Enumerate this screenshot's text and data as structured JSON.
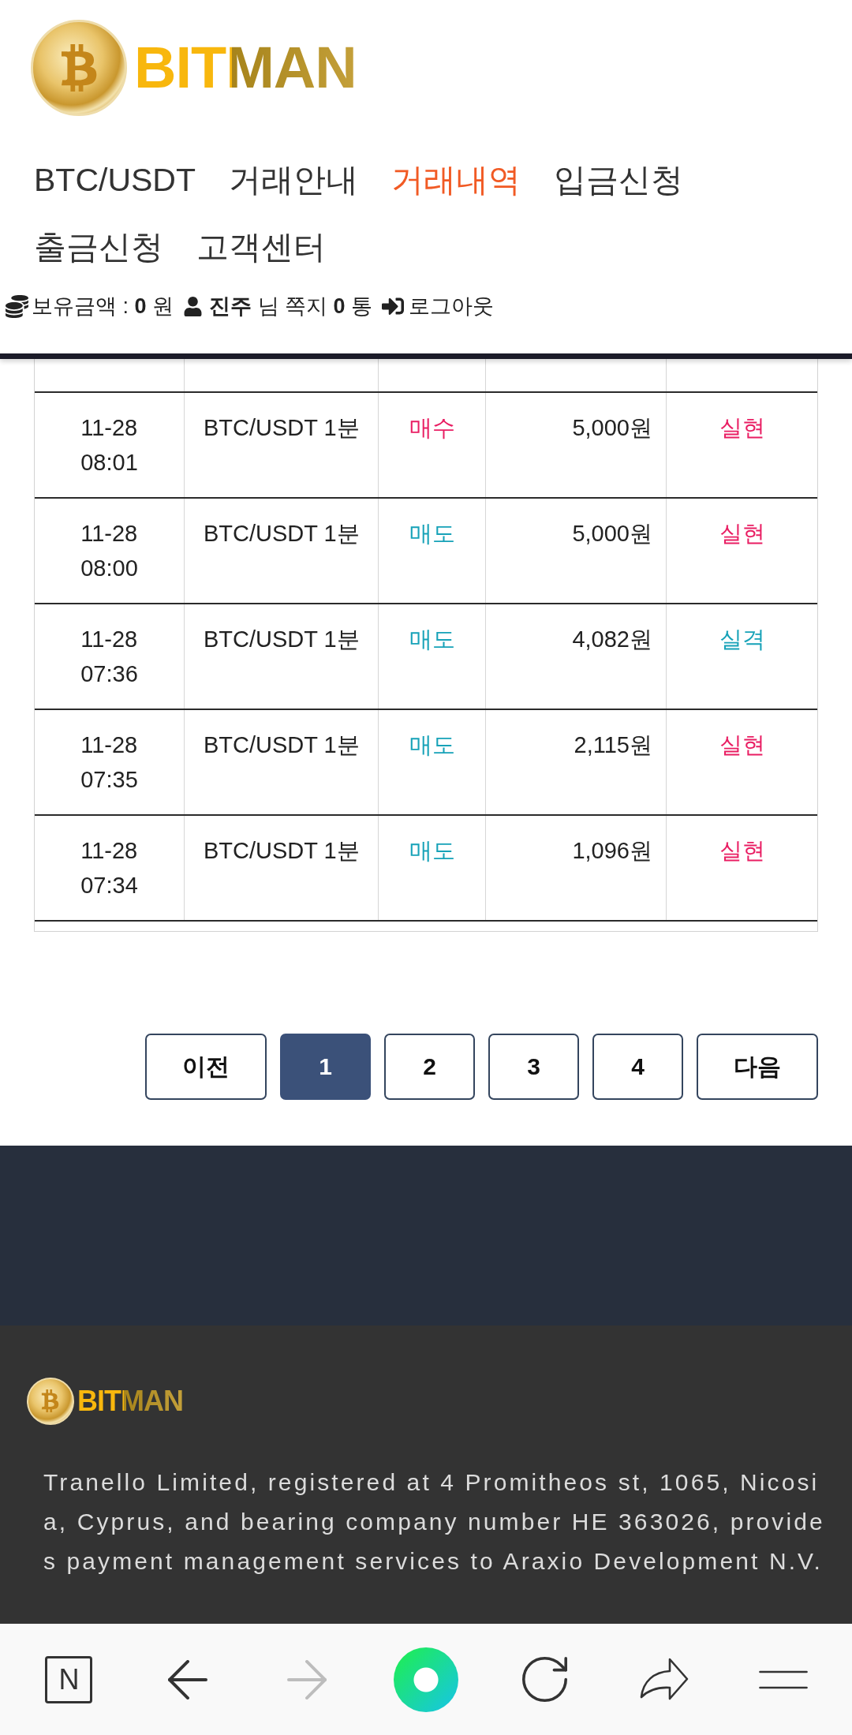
{
  "header": {
    "logo": "BITMAN"
  },
  "nav": [
    {
      "label": "BTC/USDT",
      "selected": false
    },
    {
      "label": "거래안내",
      "selected": false
    },
    {
      "label": "거래내역",
      "selected": true
    },
    {
      "label": "입금신청",
      "selected": false
    },
    {
      "label": "출금신청",
      "selected": false
    },
    {
      "label": "고객센터",
      "selected": false
    }
  ],
  "user_bar": {
    "balance": "보유금액 : **0** 원",
    "greeting": "**진주** 님 쪽지 **0** 통",
    "logout": "로그아웃"
  },
  "table": {
    "rows": [
      {
        "datetime": "11-28\n08:01",
        "market": "BTC/USDT 1분",
        "side": {
          "text": "매수",
          "color": "#e91e63"
        },
        "amount": "5,000원",
        "result": {
          "text": "실현",
          "color": "#e91e63"
        }
      },
      {
        "datetime": "11-28\n08:00",
        "market": "BTC/USDT 1분",
        "side": {
          "text": "매도",
          "color": "#17a2b8"
        },
        "amount": "5,000원",
        "result": {
          "text": "실현",
          "color": "#e91e63"
        }
      },
      {
        "datetime": "11-28\n07:36",
        "market": "BTC/USDT 1분",
        "side": {
          "text": "매도",
          "color": "#17a2b8"
        },
        "amount": "4,082원",
        "result": {
          "text": "실격",
          "color": "#17a2b8"
        }
      },
      {
        "datetime": "11-28\n07:35",
        "market": "BTC/USDT 1분",
        "side": {
          "text": "매도",
          "color": "#17a2b8"
        },
        "amount": "2,115원",
        "result": {
          "text": "실현",
          "color": "#e91e63"
        }
      },
      {
        "datetime": "11-28\n07:34",
        "market": "BTC/USDT 1분",
        "side": {
          "text": "매도",
          "color": "#17a2b8"
        },
        "amount": "1,096원",
        "result": {
          "text": "실현",
          "color": "#e91e63"
        }
      }
    ]
  },
  "pagination": [
    {
      "kind": "prev",
      "label": "이전",
      "selected": false
    },
    {
      "kind": "page",
      "label": "1",
      "selected": true
    },
    {
      "kind": "page",
      "label": "2",
      "selected": false
    },
    {
      "kind": "page",
      "label": "3",
      "selected": false
    },
    {
      "kind": "page",
      "label": "4",
      "selected": false
    },
    {
      "kind": "next",
      "label": "다음",
      "selected": false
    }
  ],
  "footer": {
    "logo": "BITMAN",
    "text": "Tranello Limited, registered at 4 Promitheos st, 1065, Nicosia, Cyprus, and bearing company number HE 363026, provides payment management services to Araxio Development N.V."
  },
  "browser_bar": [
    {
      "kind": "logo",
      "label": "N"
    },
    {
      "kind": "back",
      "disabled": false
    },
    {
      "kind": "forward",
      "disabled": true
    },
    {
      "kind": "ring"
    },
    {
      "kind": "reload"
    },
    {
      "kind": "share"
    },
    {
      "kind": "menu"
    }
  ]
}
